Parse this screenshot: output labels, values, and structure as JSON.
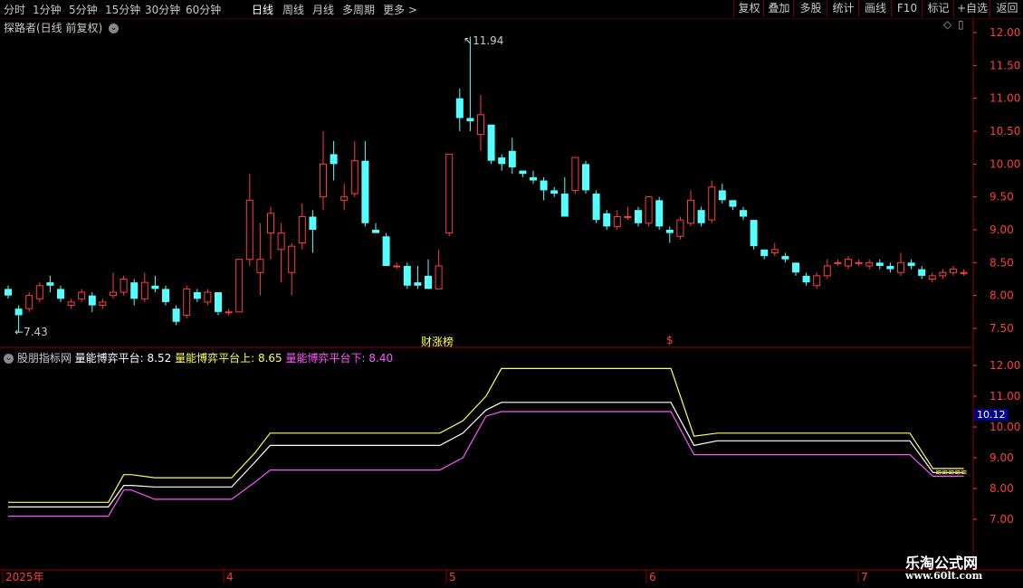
{
  "toolbar": {
    "periods": [
      "分时",
      "1分钟",
      "5分钟",
      "15分钟",
      "30分钟",
      "60分钟",
      "日线",
      "周线",
      "月线",
      "多周期",
      "更多 >"
    ],
    "active_period": "日线",
    "right_buttons": [
      "复权",
      "叠加",
      "多股",
      "统计",
      "画线",
      "F10",
      "标记",
      "+自选",
      "返回"
    ]
  },
  "main_panel": {
    "title": "探路者(日线 前复权)",
    "high_label": "11.94",
    "low_label": "7.43",
    "event_label": "财涨榜",
    "event_marker": "$",
    "y_ticks": [
      "12.00",
      "11.50",
      "11.00",
      "10.50",
      "10.00",
      "9.50",
      "9.00",
      "8.50",
      "8.00",
      "7.50"
    ]
  },
  "indicator_panel": {
    "name": "股朋指标网",
    "line1_label": "量能博弈平台:",
    "line1_value": "8.52",
    "line2_label": "量能博弈平台上:",
    "line2_value": "8.65",
    "line3_label": "量能博弈平台下:",
    "line3_value": "8.40",
    "current_tag": "10.12",
    "y_ticks": [
      "12.00",
      "11.00",
      "10.00",
      "9.00",
      "8.00",
      "7.00"
    ]
  },
  "date_axis": [
    "2025年",
    "4",
    "5",
    "6",
    "7"
  ],
  "watermark": {
    "line1": "乐淘公式网",
    "line2": "www.60lt.com"
  },
  "colors": {
    "up": "#ff3c3c",
    "down": "#54ffff",
    "plat": "#ffffff",
    "upper": "#ffff54",
    "lower": "#ff54ff"
  },
  "chart_data": [
    {
      "type": "candlestick",
      "title": "探路者(日线 前复权)",
      "ylim": [
        7.2,
        12.2
      ],
      "candles": [
        [
          8.1,
          8.0,
          8.15,
          7.95
        ],
        [
          7.8,
          7.7,
          7.85,
          7.43
        ],
        [
          7.8,
          8.0,
          8.05,
          7.75
        ],
        [
          7.95,
          8.15,
          8.2,
          7.9
        ],
        [
          8.2,
          8.15,
          8.3,
          8.05
        ],
        [
          8.1,
          7.95,
          8.15,
          7.9
        ],
        [
          7.85,
          7.9,
          7.95,
          7.8
        ],
        [
          7.95,
          8.05,
          8.1,
          7.9
        ],
        [
          8.0,
          7.85,
          8.05,
          7.75
        ],
        [
          7.85,
          7.9,
          7.95,
          7.8
        ],
        [
          8.0,
          8.05,
          8.35,
          7.95
        ],
        [
          8.05,
          8.25,
          8.3,
          8.0
        ],
        [
          8.2,
          7.95,
          8.25,
          7.85
        ],
        [
          7.95,
          8.2,
          8.35,
          7.9
        ],
        [
          8.15,
          8.1,
          8.3,
          8.05
        ],
        [
          8.1,
          7.9,
          8.15,
          7.85
        ],
        [
          7.8,
          7.6,
          7.85,
          7.55
        ],
        [
          7.7,
          8.1,
          8.15,
          7.65
        ],
        [
          8.05,
          7.95,
          8.1,
          7.9
        ],
        [
          7.9,
          8.05,
          8.1,
          7.85
        ],
        [
          8.05,
          7.75,
          8.05,
          7.7
        ],
        [
          7.75,
          7.75,
          7.8,
          7.7
        ],
        [
          7.75,
          8.55,
          8.55,
          7.75
        ],
        [
          8.55,
          9.45,
          9.85,
          8.45
        ],
        [
          8.35,
          8.55,
          9.1,
          8.0
        ],
        [
          8.95,
          9.25,
          9.35,
          8.55
        ],
        [
          8.7,
          8.95,
          9.1,
          8.2
        ],
        [
          8.35,
          8.75,
          8.8,
          8.0
        ],
        [
          8.8,
          9.2,
          9.4,
          8.7
        ],
        [
          9.2,
          9.0,
          9.3,
          8.65
        ],
        [
          9.5,
          10.0,
          10.5,
          9.3
        ],
        [
          10.15,
          10.0,
          10.35,
          9.75
        ],
        [
          9.45,
          9.5,
          9.7,
          9.3
        ],
        [
          9.55,
          10.05,
          10.35,
          9.5
        ],
        [
          10.05,
          9.1,
          10.35,
          9.05
        ],
        [
          9.0,
          8.95,
          9.1,
          8.95
        ],
        [
          8.9,
          8.45,
          8.95,
          8.45
        ],
        [
          8.45,
          8.45,
          8.5,
          8.4
        ],
        [
          8.45,
          8.15,
          8.5,
          8.1
        ],
        [
          8.2,
          8.15,
          8.45,
          8.1
        ],
        [
          8.3,
          8.1,
          8.55,
          8.1
        ],
        [
          8.1,
          8.45,
          8.7,
          8.1
        ],
        [
          8.95,
          10.15,
          10.15,
          8.9
        ],
        [
          11.0,
          10.7,
          11.15,
          10.5
        ],
        [
          10.7,
          10.65,
          11.94,
          10.5
        ],
        [
          10.45,
          10.75,
          11.05,
          10.2
        ],
        [
          10.6,
          10.05,
          10.6,
          10.0
        ],
        [
          10.1,
          10.0,
          10.15,
          9.9
        ],
        [
          10.2,
          9.95,
          10.4,
          9.85
        ],
        [
          9.9,
          9.85,
          9.9,
          9.8
        ],
        [
          9.8,
          9.75,
          9.9,
          9.7
        ],
        [
          9.75,
          9.6,
          9.8,
          9.45
        ],
        [
          9.6,
          9.55,
          9.65,
          9.5
        ],
        [
          9.55,
          9.2,
          9.8,
          9.2
        ],
        [
          9.6,
          10.1,
          10.1,
          9.55
        ],
        [
          10.0,
          9.6,
          10.05,
          9.55
        ],
        [
          9.55,
          9.15,
          9.6,
          9.1
        ],
        [
          9.25,
          9.05,
          9.3,
          9.0
        ],
        [
          9.05,
          9.2,
          9.3,
          9.0
        ],
        [
          9.2,
          9.2,
          9.35,
          9.15
        ],
        [
          9.3,
          9.1,
          9.35,
          9.05
        ],
        [
          9.1,
          9.5,
          9.5,
          9.05
        ],
        [
          9.45,
          9.05,
          9.5,
          9.0
        ],
        [
          9.0,
          8.95,
          9.05,
          8.8
        ],
        [
          8.9,
          9.15,
          9.2,
          8.85
        ],
        [
          9.1,
          9.45,
          9.6,
          9.05
        ],
        [
          9.3,
          9.1,
          9.35,
          9.05
        ],
        [
          9.15,
          9.65,
          9.75,
          9.1
        ],
        [
          9.6,
          9.45,
          9.7,
          9.4
        ],
        [
          9.45,
          9.35,
          9.45,
          9.3
        ],
        [
          9.3,
          9.2,
          9.35,
          9.15
        ],
        [
          9.15,
          8.75,
          9.15,
          8.7
        ],
        [
          8.7,
          8.6,
          8.7,
          8.55
        ],
        [
          8.65,
          8.7,
          8.8,
          8.6
        ],
        [
          8.6,
          8.55,
          8.65,
          8.5
        ],
        [
          8.5,
          8.35,
          8.5,
          8.3
        ],
        [
          8.3,
          8.2,
          8.35,
          8.15
        ],
        [
          8.15,
          8.3,
          8.35,
          8.1
        ],
        [
          8.3,
          8.45,
          8.55,
          8.25
        ],
        [
          8.5,
          8.5,
          8.55,
          8.45
        ],
        [
          8.45,
          8.55,
          8.6,
          8.4
        ],
        [
          8.5,
          8.5,
          8.55,
          8.45
        ],
        [
          8.45,
          8.5,
          8.55,
          8.4
        ],
        [
          8.5,
          8.45,
          8.55,
          8.4
        ],
        [
          8.45,
          8.4,
          8.5,
          8.35
        ],
        [
          8.35,
          8.5,
          8.65,
          8.3
        ],
        [
          8.5,
          8.45,
          8.55,
          8.4
        ],
        [
          8.4,
          8.3,
          8.45,
          8.25
        ],
        [
          8.25,
          8.3,
          8.35,
          8.2
        ],
        [
          8.3,
          8.35,
          8.4,
          8.25
        ],
        [
          8.35,
          8.4,
          8.45,
          8.3
        ],
        [
          8.35,
          8.35,
          8.4,
          8.3
        ]
      ]
    },
    {
      "type": "line",
      "title": "股朋指标网",
      "ylim": [
        6.2,
        12.4
      ],
      "series": [
        {
          "name": "量能博弈平台上",
          "color": "#ffff54",
          "steps": [
            [
              0,
              7.55
            ],
            [
              13,
              7.55
            ],
            [
              15,
              8.45
            ],
            [
              16,
              8.45
            ],
            [
              19,
              8.35
            ],
            [
              29,
              8.35
            ],
            [
              32,
              9.15
            ],
            [
              34,
              9.8
            ],
            [
              56,
              9.8
            ],
            [
              59,
              10.2
            ],
            [
              62,
              11.0
            ],
            [
              64,
              11.9
            ],
            [
              86,
              11.9
            ],
            [
              89,
              9.7
            ],
            [
              92,
              9.8
            ],
            [
              117,
              9.8
            ],
            [
              120,
              8.65
            ],
            [
              124,
              8.65
            ]
          ]
        },
        {
          "name": "量能博弈平台",
          "color": "#ffffff",
          "steps": [
            [
              0,
              7.4
            ],
            [
              13,
              7.4
            ],
            [
              15,
              8.1
            ],
            [
              16,
              8.1
            ],
            [
              19,
              8.05
            ],
            [
              29,
              8.05
            ],
            [
              32,
              8.85
            ],
            [
              34,
              9.4
            ],
            [
              56,
              9.4
            ],
            [
              59,
              9.8
            ],
            [
              62,
              10.55
            ],
            [
              64,
              10.8
            ],
            [
              86,
              10.8
            ],
            [
              89,
              9.4
            ],
            [
              92,
              9.55
            ],
            [
              117,
              9.55
            ],
            [
              120,
              8.52
            ],
            [
              124,
              8.52
            ]
          ]
        },
        {
          "name": "量能博弈平台下",
          "color": "#ff54ff",
          "steps": [
            [
              0,
              7.1
            ],
            [
              13,
              7.1
            ],
            [
              15,
              7.95
            ],
            [
              16,
              7.95
            ],
            [
              19,
              7.65
            ],
            [
              29,
              7.65
            ],
            [
              32,
              8.2
            ],
            [
              34,
              8.6
            ],
            [
              56,
              8.6
            ],
            [
              59,
              9.0
            ],
            [
              62,
              10.35
            ],
            [
              64,
              10.5
            ],
            [
              86,
              10.5
            ],
            [
              89,
              9.1
            ],
            [
              92,
              9.1
            ],
            [
              117,
              9.1
            ],
            [
              120,
              8.4
            ],
            [
              124,
              8.4
            ]
          ]
        }
      ]
    }
  ]
}
